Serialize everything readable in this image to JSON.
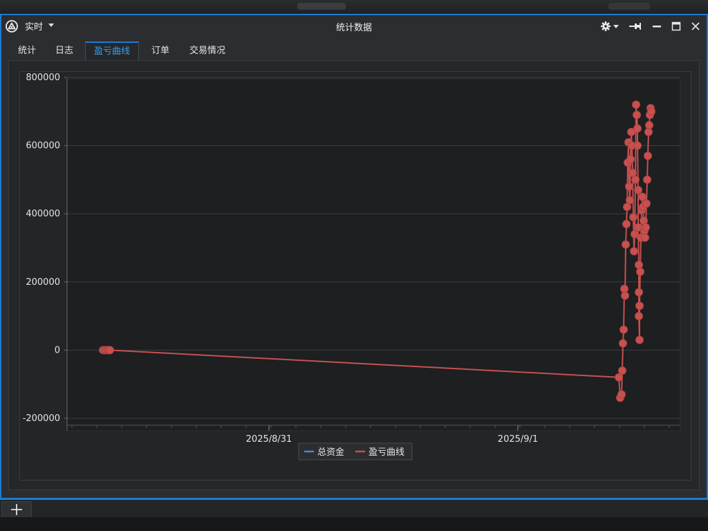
{
  "window": {
    "title": "统计数据",
    "mode_label": "实时"
  },
  "tabs": [
    {
      "label": "统计",
      "active": false
    },
    {
      "label": "日志",
      "active": false
    },
    {
      "label": "盈亏曲线",
      "active": true
    },
    {
      "label": "订单",
      "active": false
    },
    {
      "label": "交易情况",
      "active": false
    }
  ],
  "colors": {
    "accent": "#1e7bd1",
    "series_total": "#4f86c6",
    "series_pnl": "#c8504f"
  },
  "icons": {
    "app": "app-logo-icon",
    "settings": "gear-icon",
    "pin": "pin-icon",
    "minimize": "minimize-icon",
    "maximize": "maximize-icon",
    "close": "close-icon",
    "add": "plus-icon"
  },
  "chart_data": {
    "type": "line",
    "y_ticks": [
      "800000",
      "600000",
      "400000",
      "200000",
      "0",
      "-200000"
    ],
    "x_ticks": [
      "2025/8/31",
      "2025/9/1"
    ],
    "ylim": [
      -200000,
      800000
    ],
    "grid": true,
    "legend_position": "bottom-center",
    "series": [
      {
        "name": "总资金",
        "values": []
      },
      {
        "name": "盈亏曲线",
        "values": [
          0,
          0,
          0,
          0,
          0,
          0,
          -80000,
          -140000,
          -130000,
          -60000,
          20000,
          60000,
          180000,
          160000,
          310000,
          370000,
          420000,
          550000,
          610000,
          480000,
          440000,
          560000,
          640000,
          600000,
          520000,
          390000,
          290000,
          340000,
          500000,
          720000,
          690000,
          650000,
          600000,
          470000,
          360000,
          250000,
          170000,
          100000,
          30000,
          130000,
          230000,
          330000,
          410000,
          450000,
          420000,
          380000,
          350000,
          330000,
          360000,
          430000,
          500000,
          570000,
          640000,
          660000,
          690000,
          710000,
          700000
        ]
      }
    ]
  }
}
